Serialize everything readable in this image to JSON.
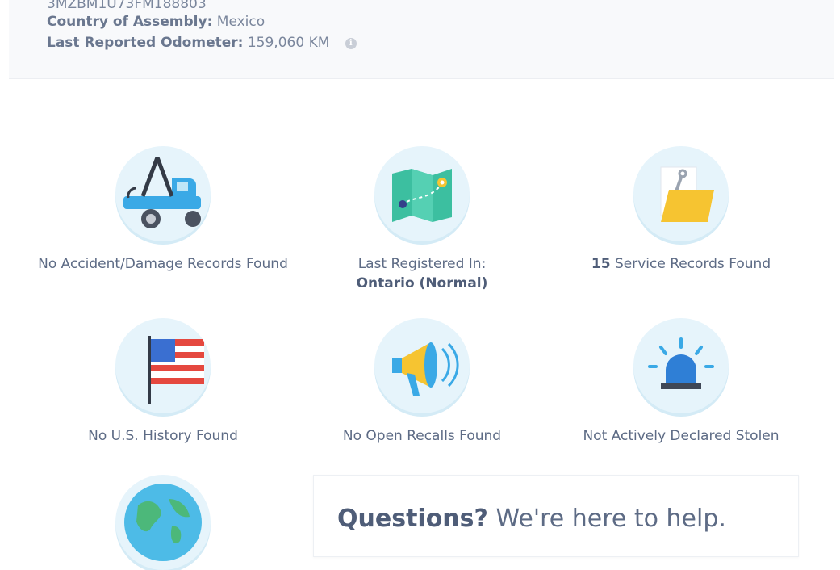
{
  "vehicle": {
    "vin": "3MZBM1U73FM188803",
    "assembly_label": "Country of Assembly:",
    "assembly_value": "Mexico",
    "odometer_label": "Last Reported Odometer:",
    "odometer_value": "159,060 KM",
    "info_glyph": "i"
  },
  "cards": {
    "accident": {
      "icon": "tow-truck-icon",
      "text": "No Accident/Damage Records Found"
    },
    "registration": {
      "icon": "map-icon",
      "label": "Last Registered In:",
      "value": "Ontario (Normal)"
    },
    "service": {
      "icon": "folder-wrench-icon",
      "count": "15",
      "text": " Service Records Found"
    },
    "us_history": {
      "icon": "us-flag-icon",
      "text": "No U.S. History Found"
    },
    "recalls": {
      "icon": "megaphone-icon",
      "text": "No Open Recalls Found"
    },
    "stolen": {
      "icon": "siren-icon",
      "text": "Not Actively Declared Stolen"
    },
    "globe": {
      "icon": "globe-icon"
    }
  },
  "help": {
    "title": "Questions?",
    "subtitle": " We're here to help."
  },
  "colors": {
    "text": "#5d6b85",
    "icon_bg": "#e6f4fb",
    "accent_blue": "#3aa9e6"
  }
}
